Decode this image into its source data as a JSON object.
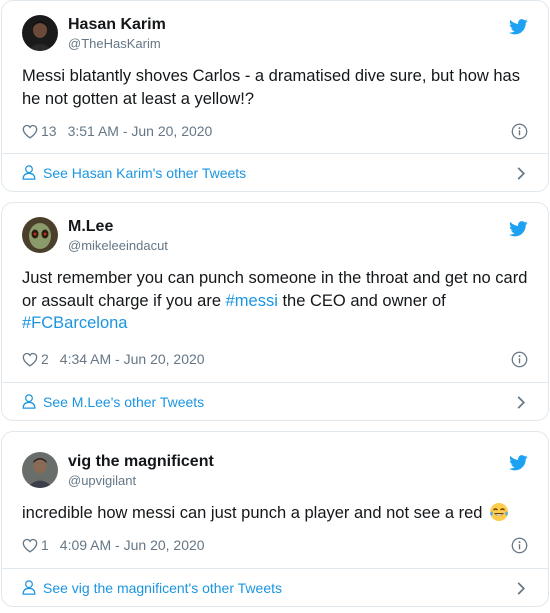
{
  "tweets": [
    {
      "name": "Hasan Karim",
      "handle": "@TheHasKarim",
      "text": "Messi blatantly shoves Carlos - a dramatised dive sure, but how has he not gotten at least a yellow!?",
      "likes": "13",
      "timestamp": "3:51 AM - Jun 20, 2020",
      "footer_link": "See Hasan Karim's other Tweets"
    },
    {
      "name": "M.Lee",
      "handle": "@mikeleeindacut",
      "text_before": "Just remember you can punch someone in the throat and get no card or assault charge if you are ",
      "hashtag_1": "#messi",
      "text_middle": " the CEO and owner of ",
      "hashtag_2": "#FCBarcelona",
      "likes": "2",
      "timestamp": "4:34 AM - Jun 20, 2020",
      "footer_link": "See M.Lee's other Tweets"
    },
    {
      "name": "vig the magnificent",
      "handle": "@upvigilant",
      "text": "incredible how messi can just punch a player and not see a red",
      "emoji": "face-with-tears-of-joy",
      "likes": "1",
      "timestamp": "4:09 AM - Jun 20, 2020",
      "footer_link": "See vig the magnificent's other Tweets"
    }
  ],
  "icons": {
    "brand": "twitter-bird-icon",
    "like": "heart-icon",
    "info": "info-icon",
    "profile": "person-icon",
    "chevron": "chevron-right-icon"
  },
  "colors": {
    "link": "#1b95e0",
    "text": "#14171a",
    "secondary": "#657786",
    "border": "#e1e8ed",
    "brand": "#1da1f2"
  }
}
